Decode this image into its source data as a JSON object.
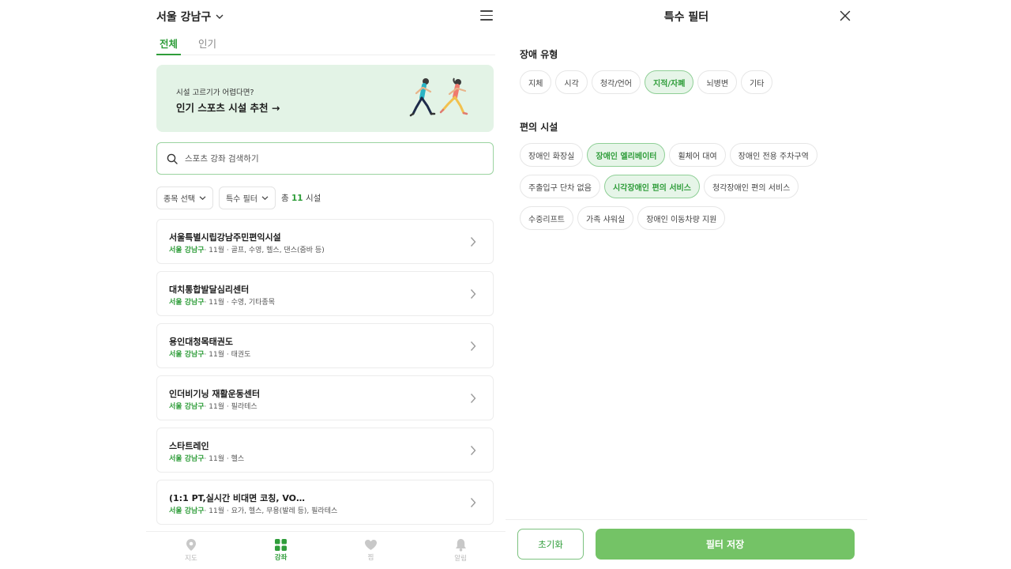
{
  "header": {
    "location": "서울 강남구"
  },
  "tabs": [
    {
      "label": "전체"
    },
    {
      "label": "인기"
    }
  ],
  "banner": {
    "subtitle": "시설 고르기가 어렵다면?",
    "title": "인기 스포츠 시설 추천 →"
  },
  "search": {
    "placeholder": "스포츠 강좌 검색하기"
  },
  "filters": {
    "sport_label": "종목 선택",
    "special_label": "특수 필터",
    "count_prefix": "총",
    "count_value": "11",
    "count_suffix": "시설"
  },
  "facilities": [
    {
      "name": "서울특별시립강남주민편익시설",
      "district": "서울 강남구",
      "detail": "· 11월 · 골프, 수영, 헬스, 댄스(줌바 등)"
    },
    {
      "name": "대치통합발달심리센터",
      "district": "서울 강남구",
      "detail": "· 11월 · 수영, 기타종목"
    },
    {
      "name": "용인대청목태권도",
      "district": "서울 강남구",
      "detail": "· 11월 · 태권도"
    },
    {
      "name": "인더비기닝 재활운동센터",
      "district": "서울 강남구",
      "detail": "· 11월 · 필라테스"
    },
    {
      "name": "스타트레인",
      "district": "서울 강남구",
      "detail": "· 11월 · 헬스"
    },
    {
      "name": "(1:1 PT,실시간 비대면 코칭, VO…",
      "district": "서울 강남구",
      "detail": "· 11월 · 요가, 헬스, 무용(발레 등), 필라테스"
    }
  ],
  "bottom_nav": [
    {
      "label": "지도",
      "icon": "map-pin-icon"
    },
    {
      "label": "강좌",
      "icon": "grid-icon"
    },
    {
      "label": "찜",
      "icon": "heart-icon"
    },
    {
      "label": "알림",
      "icon": "bell-icon"
    }
  ],
  "special_filter": {
    "title": "특수 필터",
    "disability_title": "장애 유형",
    "disability_types": [
      {
        "label": "지체",
        "selected": false
      },
      {
        "label": "시각",
        "selected": false
      },
      {
        "label": "청각/언어",
        "selected": false
      },
      {
        "label": "지적/자폐",
        "selected": true
      },
      {
        "label": "뇌병변",
        "selected": false
      },
      {
        "label": "기타",
        "selected": false
      }
    ],
    "amenities_title": "편의 시설",
    "amenities": [
      {
        "label": "장애인 화장실",
        "selected": false
      },
      {
        "label": "장애인 엘리베이터",
        "selected": true
      },
      {
        "label": "휠체어 대여",
        "selected": false
      },
      {
        "label": "장애인 전용 주차구역",
        "selected": false
      },
      {
        "label": "주출입구 단차 없음",
        "selected": false
      },
      {
        "label": "시각장애인 편의 서비스",
        "selected": true
      },
      {
        "label": "청각장애인 편의 서비스",
        "selected": false
      },
      {
        "label": "수중리프트",
        "selected": false
      },
      {
        "label": "가족 샤워실",
        "selected": false
      },
      {
        "label": "장애인 이동차량 지원",
        "selected": false
      }
    ],
    "reset_label": "초기화",
    "save_label": "필터 저장"
  },
  "colors": {
    "accent": "#2f9d3a",
    "banner_bg": "#e3f3e6",
    "save_button": "#74c366",
    "chip_selected_bg": "#e6f5e8"
  }
}
